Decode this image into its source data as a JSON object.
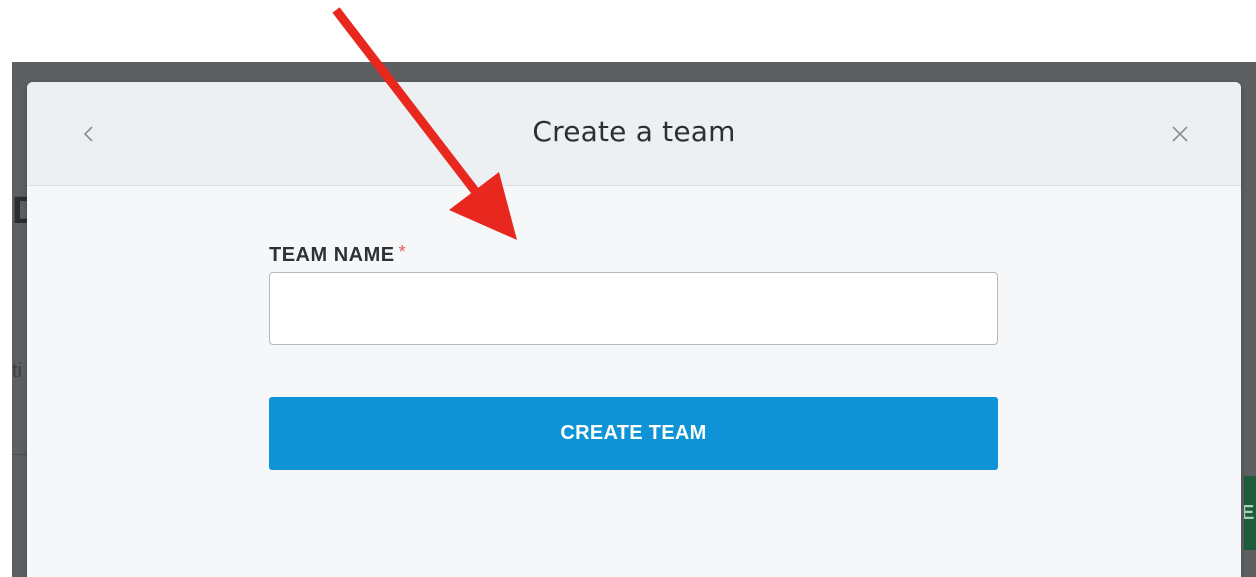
{
  "modal": {
    "title": "Create a team",
    "back_icon": "chevron-left-icon",
    "close_icon": "close-icon"
  },
  "form": {
    "team_name_label": "TEAM NAME",
    "required_marker": "*",
    "team_name_value": "",
    "team_name_placeholder": "",
    "submit_label": "CREATE TEAM"
  },
  "background": {
    "partial_heading": "D",
    "partial_text": "ti",
    "partial_button": "E"
  },
  "annotation": {
    "type": "arrow",
    "color": "#e8281e"
  },
  "colors": {
    "primary_button": "#0e94d6",
    "required": "#e45b5b",
    "overlay": "#5d5f61"
  }
}
